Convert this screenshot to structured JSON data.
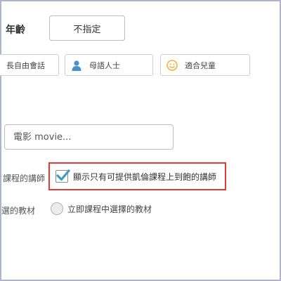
{
  "age": {
    "label": "年齡",
    "selected": "不指定"
  },
  "tags": [
    {
      "label": "長自由會話",
      "icon": "none"
    },
    {
      "label": "母語人士",
      "icon": "person-icon"
    },
    {
      "label": "適合兒童",
      "icon": "smiley-icon"
    }
  ],
  "topic": {
    "placeholder": "電影 movie..."
  },
  "teacher": {
    "label": "課程的講師",
    "checkbox_label": "顯示只有可提供凱倫課程上到飽的講師",
    "checked": true
  },
  "material": {
    "label": "選的教材",
    "radio_label": "立即課程中選擇的教材"
  },
  "colors": {
    "accent_check": "#3a9fb5",
    "person_icon": "#4a90c8",
    "smiley_icon": "#f0b23a",
    "highlight_border": "#e53935",
    "frame_border": "#aeb5c8"
  }
}
